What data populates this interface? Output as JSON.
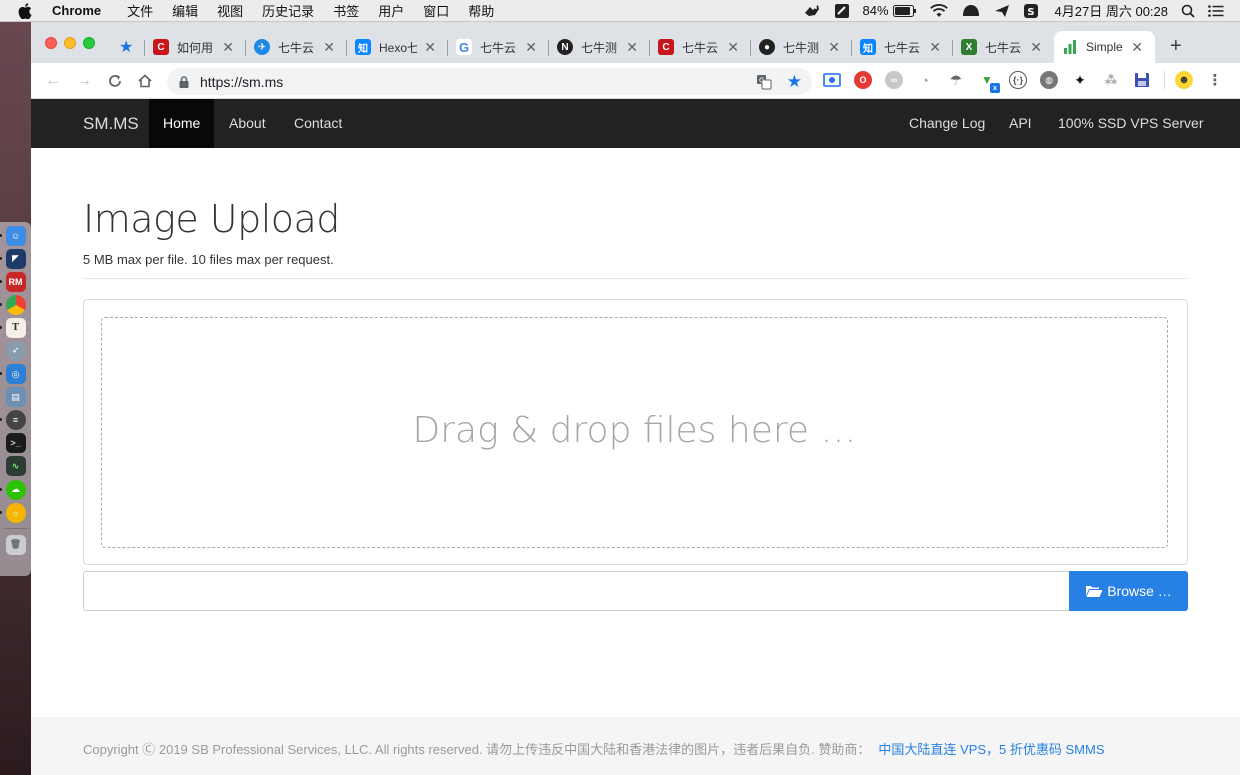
{
  "menubar": {
    "app_name": "Chrome",
    "items": [
      "文件",
      "编辑",
      "视图",
      "历史记录",
      "书签",
      "用户",
      "窗口",
      "帮助"
    ],
    "battery": "84%",
    "clock": "4月27日 周六  00:28"
  },
  "browser": {
    "tabs": [
      {
        "title": "",
        "icon": "bookmark-star-icon",
        "color": "#1a73e8",
        "pinned": true
      },
      {
        "title": "如何用",
        "icon": "csdn-icon",
        "color": "#c8161d"
      },
      {
        "title": "七牛云",
        "icon": "bird-icon",
        "color": "#1e88e5"
      },
      {
        "title": "Hexo七",
        "icon": "zhihu-icon",
        "color": "#0a84ff"
      },
      {
        "title": "七牛云",
        "icon": "google-icon",
        "color": "#4285f4"
      },
      {
        "title": "七牛测",
        "icon": "notion-icon",
        "color": "#222222"
      },
      {
        "title": "七牛云",
        "icon": "csdn-icon",
        "color": "#c8161d"
      },
      {
        "title": "七牛测",
        "icon": "github-icon",
        "color": "#222222"
      },
      {
        "title": "七牛云",
        "icon": "zhihu-icon",
        "color": "#0a84ff"
      },
      {
        "title": "七牛云",
        "icon": "excel-icon",
        "color": "#2e7d32"
      },
      {
        "title": "Simple",
        "icon": "bar-chart-icon",
        "color": "#34a853",
        "active": true
      }
    ],
    "url": "https://sm.ms"
  },
  "site": {
    "brand": "SM.MS",
    "nav_left": [
      "Home",
      "About",
      "Contact"
    ],
    "nav_right": [
      "Change Log",
      "API",
      "100% SSD VPS Server"
    ],
    "title": "Image Upload",
    "subtitle": "5 MB max per file. 10 files max per request.",
    "dropzone_text": "Drag & drop files here …",
    "browse_label": "Browse …",
    "accent": "#2780e3",
    "footer_text": "Copyright Ⓒ 2019 SB Professional Services, LLC. All rights reserved. 请勿上传违反中国大陆和香港法律的图片，违者后果自负. 赞助商：",
    "footer_link": "中国大陆直连 VPS，5 折优惠码 SMMS"
  }
}
